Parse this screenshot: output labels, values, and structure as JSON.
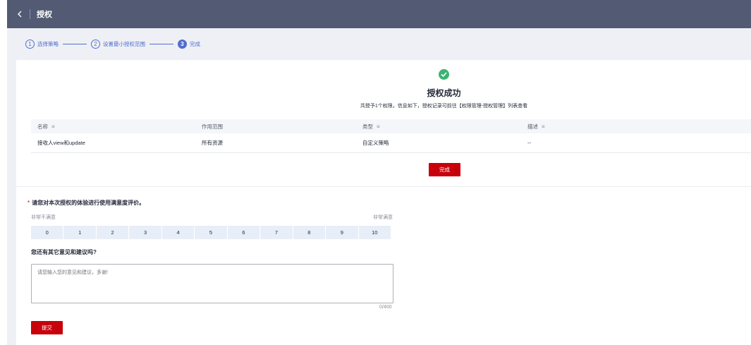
{
  "header": {
    "title": "授权"
  },
  "steps": [
    {
      "num": "1",
      "label": "选择策略"
    },
    {
      "num": "2",
      "label": "设置最小授权范围"
    },
    {
      "num": "3",
      "label": "完成"
    }
  ],
  "success": {
    "title": "授权成功",
    "desc": "共授予1个权限，信息如下，授权记录可前往【权限管理-授权管理】列表查看"
  },
  "table": {
    "headers": [
      "名称",
      "作用范围",
      "类型",
      "描述"
    ],
    "sort_icon": "≡",
    "rows": [
      [
        "接收人view和update",
        "所有资源",
        "自定义策略",
        "--"
      ]
    ]
  },
  "done_button": "完成",
  "rating": {
    "required_mark": "*",
    "question": "请您对本次授权的体验进行使用满意度评价。",
    "low_label": "非常不满意",
    "high_label": "非常满意",
    "scale": [
      "0",
      "1",
      "2",
      "3",
      "4",
      "5",
      "6",
      "7",
      "8",
      "9",
      "10"
    ]
  },
  "feedback": {
    "question": "您还有其它意见和建议吗?",
    "placeholder": "请您输入您的意见和建议，多谢!",
    "value": "",
    "counter": "0/400"
  },
  "submit_button": "提交",
  "colors": {
    "header_bg": "#525a74",
    "primary": "#c7000b",
    "accent": "#526ecc",
    "success": "#3cb371"
  }
}
